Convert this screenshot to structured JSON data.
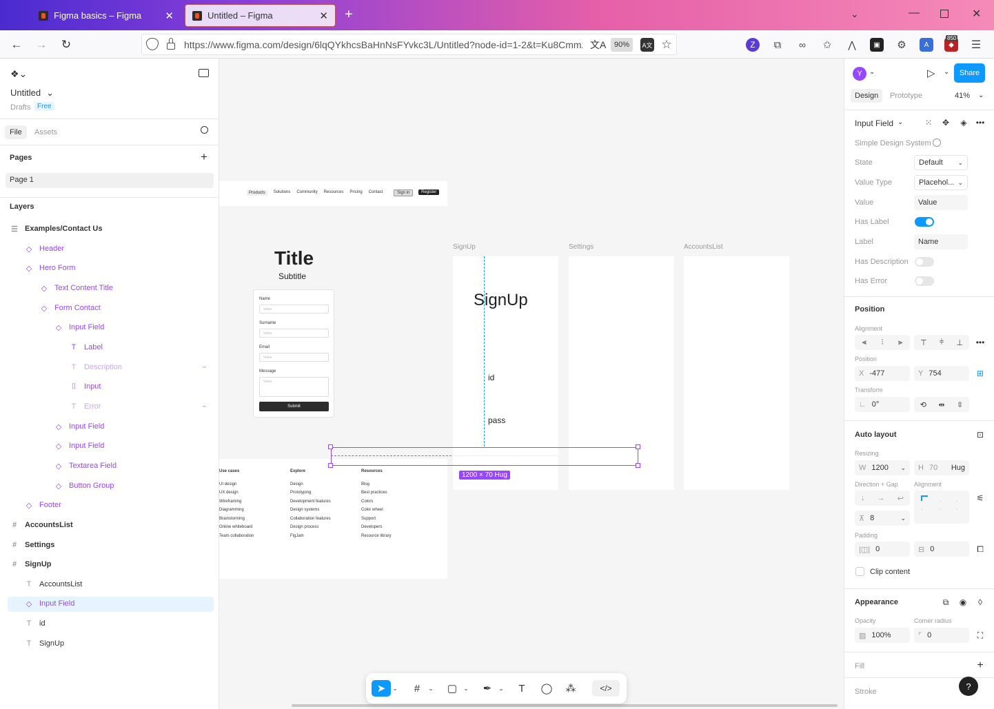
{
  "browser": {
    "tabs": [
      {
        "title": "Figma basics – Figma"
      },
      {
        "title": "Untitled – Figma"
      }
    ],
    "new_tab": "+",
    "url": "https://www.figma.com/design/6lqQYkhcsBaHnNsFYvkc3L/Untitled?node-id=1-2&t=Ku8Cmmz",
    "zoom": "90%",
    "ext_badge": "850",
    "ext_letter": "Z"
  },
  "left": {
    "file_name": "Untitled",
    "drafts": "Drafts",
    "plan": "Free",
    "tabs": {
      "file": "File",
      "assets": "Assets"
    },
    "pages_header": "Pages",
    "pages": [
      "Page 1"
    ],
    "layers_header": "Layers",
    "layers": [
      {
        "name": "Examples/Contact Us",
        "icon": "section-icon"
      },
      {
        "name": "Header",
        "icon": "component-instance-icon"
      },
      {
        "name": "Hero Form",
        "icon": "component-instance-icon"
      },
      {
        "name": "Text Content Title",
        "icon": "component-instance-icon"
      },
      {
        "name": "Form Contact",
        "icon": "component-instance-icon"
      },
      {
        "name": "Input Field",
        "icon": "component-instance-icon"
      },
      {
        "name": "Label",
        "icon": "text-icon"
      },
      {
        "name": "Description",
        "icon": "text-icon"
      },
      {
        "name": "Input",
        "icon": "input-icon"
      },
      {
        "name": "Error",
        "icon": "text-icon"
      },
      {
        "name": "Input Field",
        "icon": "component-instance-icon"
      },
      {
        "name": "Input Field",
        "icon": "component-instance-icon"
      },
      {
        "name": "Textarea Field",
        "icon": "component-instance-icon"
      },
      {
        "name": "Button Group",
        "icon": "component-instance-icon"
      },
      {
        "name": "Footer",
        "icon": "component-instance-icon"
      },
      {
        "name": "AccountsList",
        "icon": "frame-icon"
      },
      {
        "name": "Settings",
        "icon": "frame-icon"
      },
      {
        "name": "SignUp",
        "icon": "frame-icon"
      },
      {
        "name": "AccountsList",
        "icon": "text-icon"
      },
      {
        "name": "Input Field",
        "icon": "component-instance-icon"
      },
      {
        "name": "id",
        "icon": "text-icon"
      },
      {
        "name": "SignUp",
        "icon": "text-icon"
      }
    ]
  },
  "canvas": {
    "nav": [
      "Products",
      "Solutions",
      "Community",
      "Resources",
      "Pricing",
      "Contact"
    ],
    "nav_sign_in": "Sign in",
    "nav_register": "Register",
    "hero_title": "Title",
    "hero_subtitle": "Subtitle",
    "form": {
      "name_label": "Name",
      "surname_label": "Surname",
      "email_label": "Email",
      "message_label": "Message",
      "placeholder": "Value",
      "submit": "Submit"
    },
    "frames": {
      "signup": "SignUp",
      "settings": "Settings",
      "accounts": "AccountsList"
    },
    "signup_title": "SignUp",
    "signup_id": "id",
    "signup_pass": "pass",
    "selection_size": "1200 × 70 Hug",
    "footer": {
      "columns": [
        {
          "title": "Use cases",
          "items": [
            "UI design",
            "UX design",
            "Wireframing",
            "Diagramming",
            "Brainstorming",
            "Online whiteboard",
            "Team collaboration"
          ]
        },
        {
          "title": "Explore",
          "items": [
            "Design",
            "Prototyping",
            "Development features",
            "Design systems",
            "Collaboration features",
            "Design process",
            "FigJam"
          ]
        },
        {
          "title": "Resources",
          "items": [
            "Blog",
            "Best practices",
            "Colors",
            "Color wheel",
            "Support",
            "Developers",
            "Resource library"
          ]
        }
      ]
    }
  },
  "right": {
    "avatar": "Y",
    "share": "Share",
    "tabs": {
      "design": "Design",
      "prototype": "Prototype"
    },
    "zoom": "41%",
    "component_name": "Input Field",
    "library": "Simple Design System",
    "props": {
      "state_label": "State",
      "state_value": "Default",
      "value_type_label": "Value Type",
      "value_type_value": "Placehol...",
      "value_label": "Value",
      "value_value": "Value",
      "has_label_label": "Has Label",
      "has_label_on": true,
      "label_label": "Label",
      "label_value": "Name",
      "has_description_label": "Has Description",
      "has_description_on": false,
      "has_error_label": "Has Error",
      "has_error_on": false
    },
    "position": {
      "header": "Position",
      "alignment_label": "Alignment",
      "position_label": "Position",
      "x_label": "X",
      "x": "-477",
      "y_label": "Y",
      "y": "754",
      "transform_label": "Transform",
      "rotation": "0°"
    },
    "auto_layout": {
      "header": "Auto layout",
      "resizing_label": "Resizing",
      "w_label": "W",
      "w": "1200",
      "h_label": "H",
      "h": "70",
      "h_mode": "Hug",
      "direction_label": "Direction + Gap",
      "alignment_label": "Alignment",
      "gap": "8",
      "padding_label": "Padding",
      "padding_h": "0",
      "padding_v": "0",
      "clip": "Clip content"
    },
    "appearance": {
      "header": "Appearance",
      "opacity_label": "Opacity",
      "opacity": "100%",
      "radius_label": "Corner radius",
      "radius": "0"
    },
    "fill": "Fill",
    "stroke": "Stroke",
    "help": "?"
  },
  "colors": {
    "accent": "#0d99ff",
    "component": "#9747ff",
    "selection": "#9747ff"
  }
}
